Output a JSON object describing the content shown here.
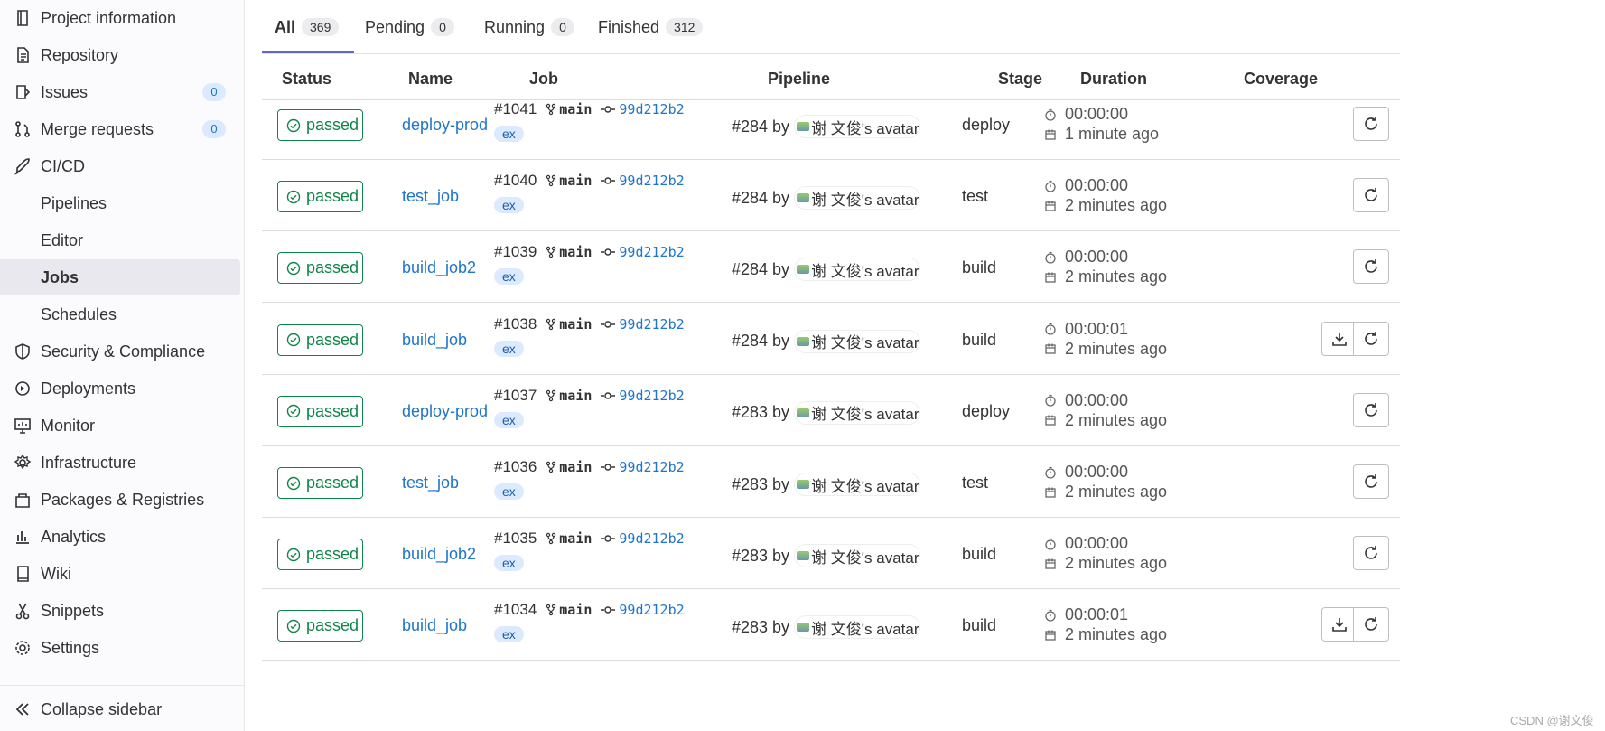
{
  "sidebar": {
    "items": [
      {
        "label": "Project information",
        "icon": "project-icon"
      },
      {
        "label": "Repository",
        "icon": "document-icon"
      },
      {
        "label": "Issues",
        "icon": "issues-icon",
        "badge": "0"
      },
      {
        "label": "Merge requests",
        "icon": "merge-request-icon",
        "badge": "0"
      },
      {
        "label": "CI/CD",
        "icon": "rocket-icon"
      },
      {
        "label": "Pipelines"
      },
      {
        "label": "Editor"
      },
      {
        "label": "Jobs",
        "active": true
      },
      {
        "label": "Schedules"
      },
      {
        "label": "Security & Compliance",
        "icon": "shield-icon"
      },
      {
        "label": "Deployments",
        "icon": "deployments-icon"
      },
      {
        "label": "Monitor",
        "icon": "monitor-icon"
      },
      {
        "label": "Infrastructure",
        "icon": "cloud-gear-icon"
      },
      {
        "label": "Packages & Registries",
        "icon": "package-icon"
      },
      {
        "label": "Analytics",
        "icon": "chart-icon"
      },
      {
        "label": "Wiki",
        "icon": "book-icon"
      },
      {
        "label": "Snippets",
        "icon": "scissors-icon"
      },
      {
        "label": "Settings",
        "icon": "gear-icon"
      }
    ],
    "collapse_label": "Collapse sidebar"
  },
  "tabs": [
    {
      "label": "All",
      "count": "369",
      "active": true
    },
    {
      "label": "Pending",
      "count": "0"
    },
    {
      "label": "Running",
      "count": "0"
    },
    {
      "label": "Finished",
      "count": "312"
    }
  ],
  "table": {
    "headers": [
      "Status",
      "Name",
      "Job",
      "Pipeline",
      "Stage",
      "Duration",
      "Coverage"
    ],
    "rows": [
      {
        "status": "passed",
        "name": "deploy-prod",
        "job_id": "#1041",
        "branch": "main",
        "sha": "99d212b2",
        "tag": "ex",
        "pipeline": "#284 by",
        "avatar": "谢 文俊's avatar",
        "stage": "deploy",
        "duration": "00:00:00",
        "finished": "1 minute ago",
        "artifact": false
      },
      {
        "status": "passed",
        "name": "test_job",
        "job_id": "#1040",
        "branch": "main",
        "sha": "99d212b2",
        "tag": "ex",
        "pipeline": "#284 by",
        "avatar": "谢 文俊's avatar",
        "stage": "test",
        "duration": "00:00:00",
        "finished": "2 minutes ago",
        "artifact": false
      },
      {
        "status": "passed",
        "name": "build_job2",
        "job_id": "#1039",
        "branch": "main",
        "sha": "99d212b2",
        "tag": "ex",
        "pipeline": "#284 by",
        "avatar": "谢 文俊's avatar",
        "stage": "build",
        "duration": "00:00:00",
        "finished": "2 minutes ago",
        "artifact": false
      },
      {
        "status": "passed",
        "name": "build_job",
        "job_id": "#1038",
        "branch": "main",
        "sha": "99d212b2",
        "tag": "ex",
        "pipeline": "#284 by",
        "avatar": "谢 文俊's avatar",
        "stage": "build",
        "duration": "00:00:01",
        "finished": "2 minutes ago",
        "artifact": true
      },
      {
        "status": "passed",
        "name": "deploy-prod",
        "job_id": "#1037",
        "branch": "main",
        "sha": "99d212b2",
        "tag": "ex",
        "pipeline": "#283 by",
        "avatar": "谢 文俊's avatar",
        "stage": "deploy",
        "duration": "00:00:00",
        "finished": "2 minutes ago",
        "artifact": false
      },
      {
        "status": "passed",
        "name": "test_job",
        "job_id": "#1036",
        "branch": "main",
        "sha": "99d212b2",
        "tag": "ex",
        "pipeline": "#283 by",
        "avatar": "谢 文俊's avatar",
        "stage": "test",
        "duration": "00:00:00",
        "finished": "2 minutes ago",
        "artifact": false
      },
      {
        "status": "passed",
        "name": "build_job2",
        "job_id": "#1035",
        "branch": "main",
        "sha": "99d212b2",
        "tag": "ex",
        "pipeline": "#283 by",
        "avatar": "谢 文俊's avatar",
        "stage": "build",
        "duration": "00:00:00",
        "finished": "2 minutes ago",
        "artifact": false
      },
      {
        "status": "passed",
        "name": "build_job",
        "job_id": "#1034",
        "branch": "main",
        "sha": "99d212b2",
        "tag": "ex",
        "pipeline": "#283 by",
        "avatar": "谢 文俊's avatar",
        "stage": "build",
        "duration": "00:00:01",
        "finished": "2 minutes ago",
        "artifact": true
      }
    ]
  },
  "watermark": "CSDN @谢文俊",
  "colors": {
    "passed": "#108548",
    "link": "#1f75cb",
    "active_tab": "#6666c4"
  }
}
